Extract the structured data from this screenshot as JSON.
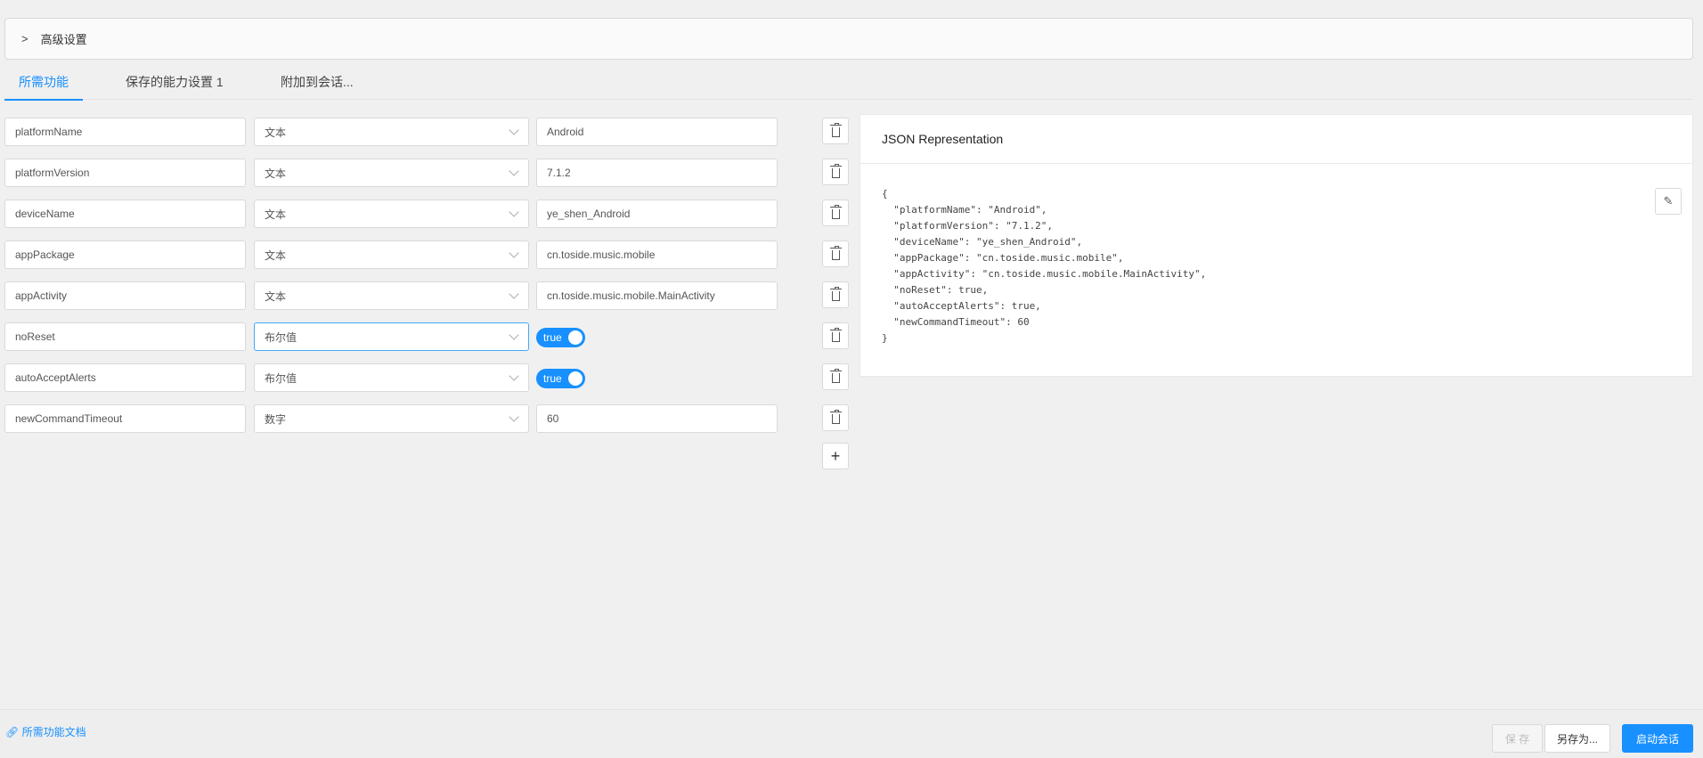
{
  "advanced": {
    "label": "高级设置"
  },
  "tabs": [
    {
      "label": "所需功能",
      "active": true
    },
    {
      "label": "保存的能力设置 1",
      "active": false
    },
    {
      "label": "附加到会话...",
      "active": false
    }
  ],
  "capabilities": [
    {
      "name": "platformName",
      "type": "文本",
      "value": "Android"
    },
    {
      "name": "platformVersion",
      "type": "文本",
      "value": "7.1.2"
    },
    {
      "name": "deviceName",
      "type": "文本",
      "value": "ye_shen_Android"
    },
    {
      "name": "appPackage",
      "type": "文本",
      "value": "cn.toside.music.mobile"
    },
    {
      "name": "appActivity",
      "type": "文本",
      "value": "cn.toside.music.mobile.MainActivity"
    },
    {
      "name": "noReset",
      "type": "布尔值",
      "value": "true"
    },
    {
      "name": "autoAcceptAlerts",
      "type": "布尔值",
      "value": "true"
    },
    {
      "name": "newCommandTimeout",
      "type": "数字",
      "value": "60"
    }
  ],
  "add_label": "+",
  "json_panel": {
    "title": "JSON Representation",
    "content": "{\n  \"platformName\": \"Android\",\n  \"platformVersion\": \"7.1.2\",\n  \"deviceName\": \"ye_shen_Android\",\n  \"appPackage\": \"cn.toside.music.mobile\",\n  \"appActivity\": \"cn.toside.music.mobile.MainActivity\",\n  \"noReset\": true,\n  \"autoAcceptAlerts\": true,\n  \"newCommandTimeout\": 60\n}"
  },
  "footer": {
    "doc_link": "所需功能文档",
    "save": "保 存",
    "save_as": "另存为...",
    "start": "启动会话"
  },
  "colors": {
    "accent": "#1890ff"
  }
}
